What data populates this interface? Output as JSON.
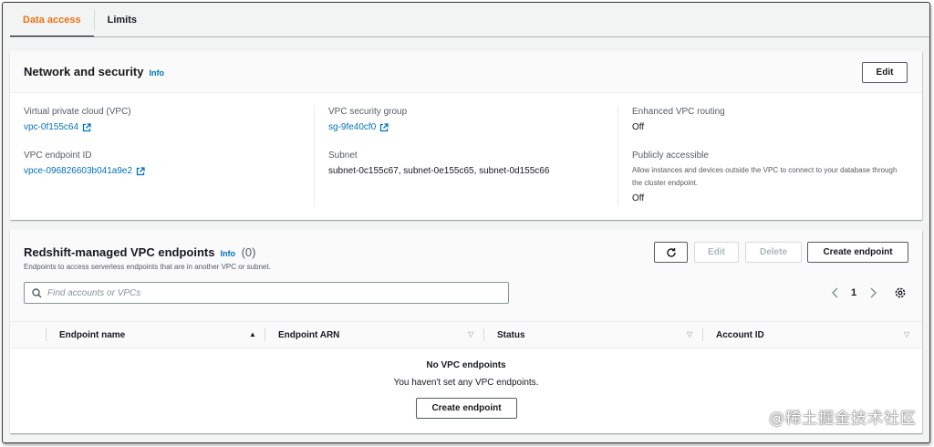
{
  "tabs": [
    {
      "label": "Data access",
      "active": true
    },
    {
      "label": "Limits",
      "active": false
    }
  ],
  "network": {
    "title": "Network and security",
    "info": "Info",
    "edit_label": "Edit",
    "vpc_label": "Virtual private cloud (VPC)",
    "vpc_value": "vpc-0f155c64",
    "endpoint_id_label": "VPC endpoint ID",
    "endpoint_id_value": "vpce-096826603b041a9e2",
    "sg_label": "VPC security group",
    "sg_value": "sg-9fe40cf0",
    "subnet_label": "Subnet",
    "subnet_value": "subnet-0c155c67, subnet-0e155c65, subnet-0d155c66",
    "enhanced_label": "Enhanced VPC routing",
    "enhanced_value": "Off",
    "public_label": "Publicly accessible",
    "public_desc": "Allow instances and devices outside the VPC to connect to your database through the cluster endpoint.",
    "public_value": "Off"
  },
  "endpoints": {
    "title": "Redshift-managed VPC endpoints",
    "info": "Info",
    "count": "(0)",
    "description": "Endpoints to access serverless endpoints that are in another VPC or subnet.",
    "edit_label": "Edit",
    "delete_label": "Delete",
    "create_label": "Create endpoint",
    "search_placeholder": "Find accounts or VPCs",
    "page": "1",
    "columns": [
      "Endpoint name",
      "Endpoint ARN",
      "Status",
      "Account ID"
    ],
    "empty_title": "No VPC endpoints",
    "empty_message": "You haven't set any VPC endpoints.",
    "empty_create_label": "Create endpoint"
  },
  "watermark": "@稀土掘金技术社区",
  "colors": {
    "accent": "#ec7211",
    "link": "#0073bb",
    "background": "#f2f3f3"
  },
  "icons": [
    "external-link-icon",
    "refresh-icon",
    "search-icon",
    "chevron-left-icon",
    "chevron-right-icon",
    "settings-gear-icon",
    "sort-ascending-icon",
    "sort-icon"
  ]
}
